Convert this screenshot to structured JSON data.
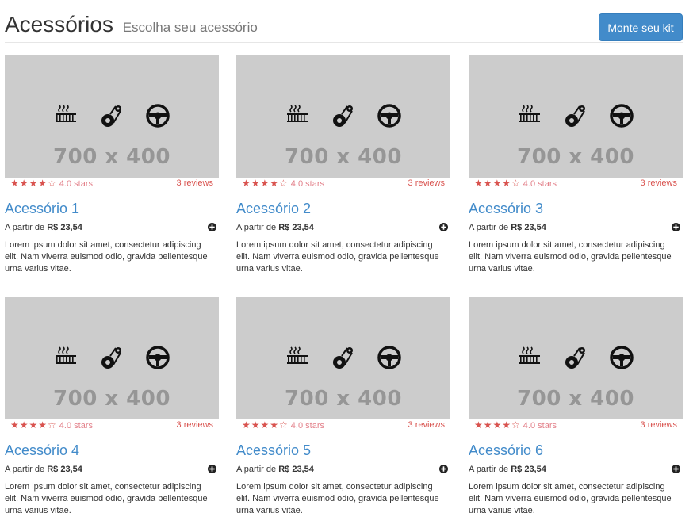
{
  "header": {
    "title": "Acessórios",
    "subtitle": "Escolha seu acessório",
    "kit_button_label": "Monte seu kit"
  },
  "colors": {
    "primary": "#428bca",
    "stars": "#d9534f",
    "placeholder_bg": "#cccccc",
    "placeholder_text": "#969696"
  },
  "products": [
    {
      "name": "Acessório 1",
      "image_label": "700 x 400",
      "stars": "★★★★☆",
      "rating_text": "4.0 stars",
      "reviews_text": "3 reviews",
      "price_prefix": "A partir de",
      "price": "R$ 23,54",
      "description": "Lorem ipsum dolor sit amet, consectetur adipiscing elit. Nam viverra euismod odio, gravida pellentesque urna varius vitae."
    },
    {
      "name": "Acessório 2",
      "image_label": "700 x 400",
      "stars": "★★★★☆",
      "rating_text": "4.0 stars",
      "reviews_text": "3 reviews",
      "price_prefix": "A partir de",
      "price": "R$ 23,54",
      "description": "Lorem ipsum dolor sit amet, consectetur adipiscing elit. Nam viverra euismod odio, gravida pellentesque urna varius vitae."
    },
    {
      "name": "Acessório 3",
      "image_label": "700 x 400",
      "stars": "★★★★☆",
      "rating_text": "4.0 stars",
      "reviews_text": "3 reviews",
      "price_prefix": "A partir de",
      "price": "R$ 23,54",
      "description": "Lorem ipsum dolor sit amet, consectetur adipiscing elit. Nam viverra euismod odio, gravida pellentesque urna varius vitae."
    },
    {
      "name": "Acessório 4",
      "image_label": "700 x 400",
      "stars": "★★★★☆",
      "rating_text": "4.0 stars",
      "reviews_text": "3 reviews",
      "price_prefix": "A partir de",
      "price": "R$ 23,54",
      "description": "Lorem ipsum dolor sit amet, consectetur adipiscing elit. Nam viverra euismod odio, gravida pellentesque urna varius vitae."
    },
    {
      "name": "Acessório 5",
      "image_label": "700 x 400",
      "stars": "★★★★☆",
      "rating_text": "4.0 stars",
      "reviews_text": "3 reviews",
      "price_prefix": "A partir de",
      "price": "R$ 23,54",
      "description": "Lorem ipsum dolor sit amet, consectetur adipiscing elit. Nam viverra euismod odio, gravida pellentesque urna varius vitae."
    },
    {
      "name": "Acessório 6",
      "image_label": "700 x 400",
      "stars": "★★★★☆",
      "rating_text": "4.0 stars",
      "reviews_text": "3 reviews",
      "price_prefix": "A partir de",
      "price": "R$ 23,54",
      "description": "Lorem ipsum dolor sit amet, consectetur adipiscing elit. Nam viverra euismod odio, gravida pellentesque urna varius vitae."
    }
  ]
}
